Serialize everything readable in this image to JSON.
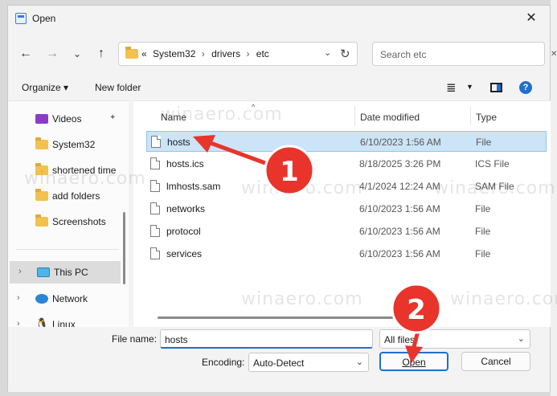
{
  "window": {
    "title": "Open",
    "close_glyph": "✕"
  },
  "nav": {
    "back": "←",
    "forward": "→",
    "recent": "⌄",
    "up": "↑"
  },
  "address": {
    "overflow": "«",
    "crumbs": [
      "System32",
      "drivers",
      "etc"
    ],
    "sep": "›",
    "dropdown": "⌄",
    "refresh": "↻"
  },
  "search": {
    "placeholder": "Search etc"
  },
  "toolbar": {
    "organize": "Organize ▾",
    "new_folder": "New folder",
    "view_glyph": "≣",
    "view_dd": "▼",
    "help": "?"
  },
  "sidebar": {
    "items": [
      {
        "label": "Videos",
        "icon": "video-icon",
        "pinned": true
      },
      {
        "label": "System32",
        "icon": "folder-icon"
      },
      {
        "label": "shortened time",
        "icon": "folder-icon"
      },
      {
        "label": "add folders",
        "icon": "folder-icon"
      },
      {
        "label": "Screenshots",
        "icon": "folder-icon"
      },
      {
        "label": "This PC",
        "icon": "pc-icon",
        "selected": true
      },
      {
        "label": "Network",
        "icon": "network-icon"
      },
      {
        "label": "Linux",
        "icon": "linux-icon"
      }
    ],
    "pin_glyph": "📌",
    "chevron": "›"
  },
  "columns": {
    "name": "Name",
    "date": "Date modified",
    "type": "Type",
    "sort_glyph": "^"
  },
  "files": [
    {
      "name": "hosts",
      "date": "6/10/2023 1:56 AM",
      "type": "File",
      "selected": true
    },
    {
      "name": "hosts.ics",
      "date": "8/18/2025 3:26 PM",
      "type": "ICS File"
    },
    {
      "name": "lmhosts.sam",
      "date": "4/1/2024 12:24 AM",
      "type": "SAM File"
    },
    {
      "name": "networks",
      "date": "6/10/2023 1:56 AM",
      "type": "File"
    },
    {
      "name": "protocol",
      "date": "6/10/2023 1:56 AM",
      "type": "File"
    },
    {
      "name": "services",
      "date": "6/10/2023 1:56 AM",
      "type": "File"
    }
  ],
  "footer": {
    "filename_label": "File name:",
    "filename_value": "hosts",
    "filter_value": "All files",
    "encoding_label": "Encoding:",
    "encoding_value": "Auto-Detect",
    "open_label": "Open",
    "cancel_label": "Cancel",
    "dd_glyph": "⌄"
  },
  "annotations": {
    "step1": "1",
    "step2": "2",
    "color": "#e8342a"
  },
  "watermark": "winaero.com"
}
